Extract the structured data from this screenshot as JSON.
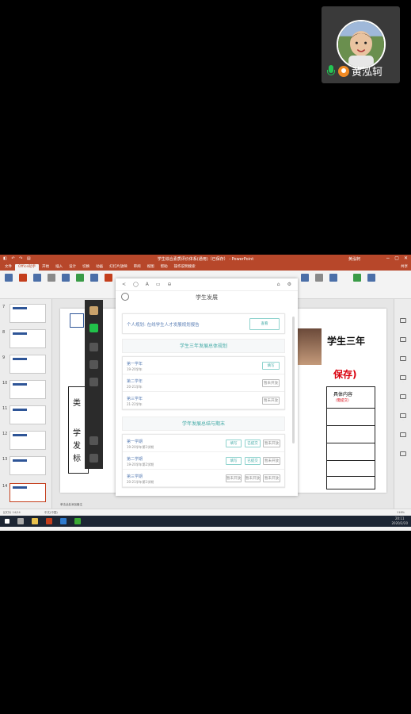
{
  "participant": {
    "name": "黄泓轲",
    "mic_color": "#23c553",
    "badge_color": "#f08a24"
  },
  "ppt": {
    "window_title": "学生综合素质评价体系(通用)（已保存） - PowerPoint",
    "user": "黄泓轲",
    "menu": [
      "文件",
      "Office助手",
      "开始",
      "插入",
      "设计",
      "切换",
      "动画",
      "幻灯片放映",
      "审阅",
      "视图",
      "帮助",
      "操作说明搜索",
      "共享"
    ],
    "slide_numbers": [
      "7",
      "8",
      "9",
      "10",
      "11",
      "12",
      "13",
      "14"
    ],
    "slide_text": {
      "title_tail": "学生三年",
      "red": "保存)",
      "left1": "类",
      "left2": "学",
      "left3": "发",
      "left4": "标",
      "tbl_head": "具体内容",
      "tbl_sub": "（需提交）"
    },
    "status": {
      "slide_info": "幻灯片 14/14",
      "lang": "中文(中国)",
      "notes": "单击此处添加备注",
      "zoom": "118%"
    },
    "time": "20:11",
    "date": "2020/2/20"
  },
  "app": {
    "top_icons": [
      "<",
      "◯",
      "A",
      "▭",
      "⊖",
      "⌂",
      "⚙"
    ],
    "title": "学生发展",
    "plan_text": "个人规划: 在线学生人才发展规划报告",
    "plan_button": "查看",
    "section1": "学生三年发展总体规划",
    "years": [
      {
        "label": "第一学年",
        "sub": "19-20学年",
        "button": "填写"
      },
      {
        "label": "第二学年",
        "sub": "20-21学年",
        "button": "暂未开放"
      },
      {
        "label": "第三学年",
        "sub": "21-22学年",
        "button": "暂未开放"
      }
    ],
    "section2": "学年发展总结与期末",
    "terms": [
      {
        "label": "第一学期",
        "sub": "19-20学年第1学期",
        "b1": "填写",
        "b2": "已提交",
        "b3": "暂未开放"
      },
      {
        "label": "第二学期",
        "sub": "19-20学年第2学期",
        "b1": "填写",
        "b2": "已提交",
        "b3": "暂未开放"
      },
      {
        "label": "第三学期",
        "sub": "20-21学年第1学期",
        "b1": "暂未开放",
        "b2": "暂未开放",
        "b3": "暂未开放"
      }
    ]
  }
}
